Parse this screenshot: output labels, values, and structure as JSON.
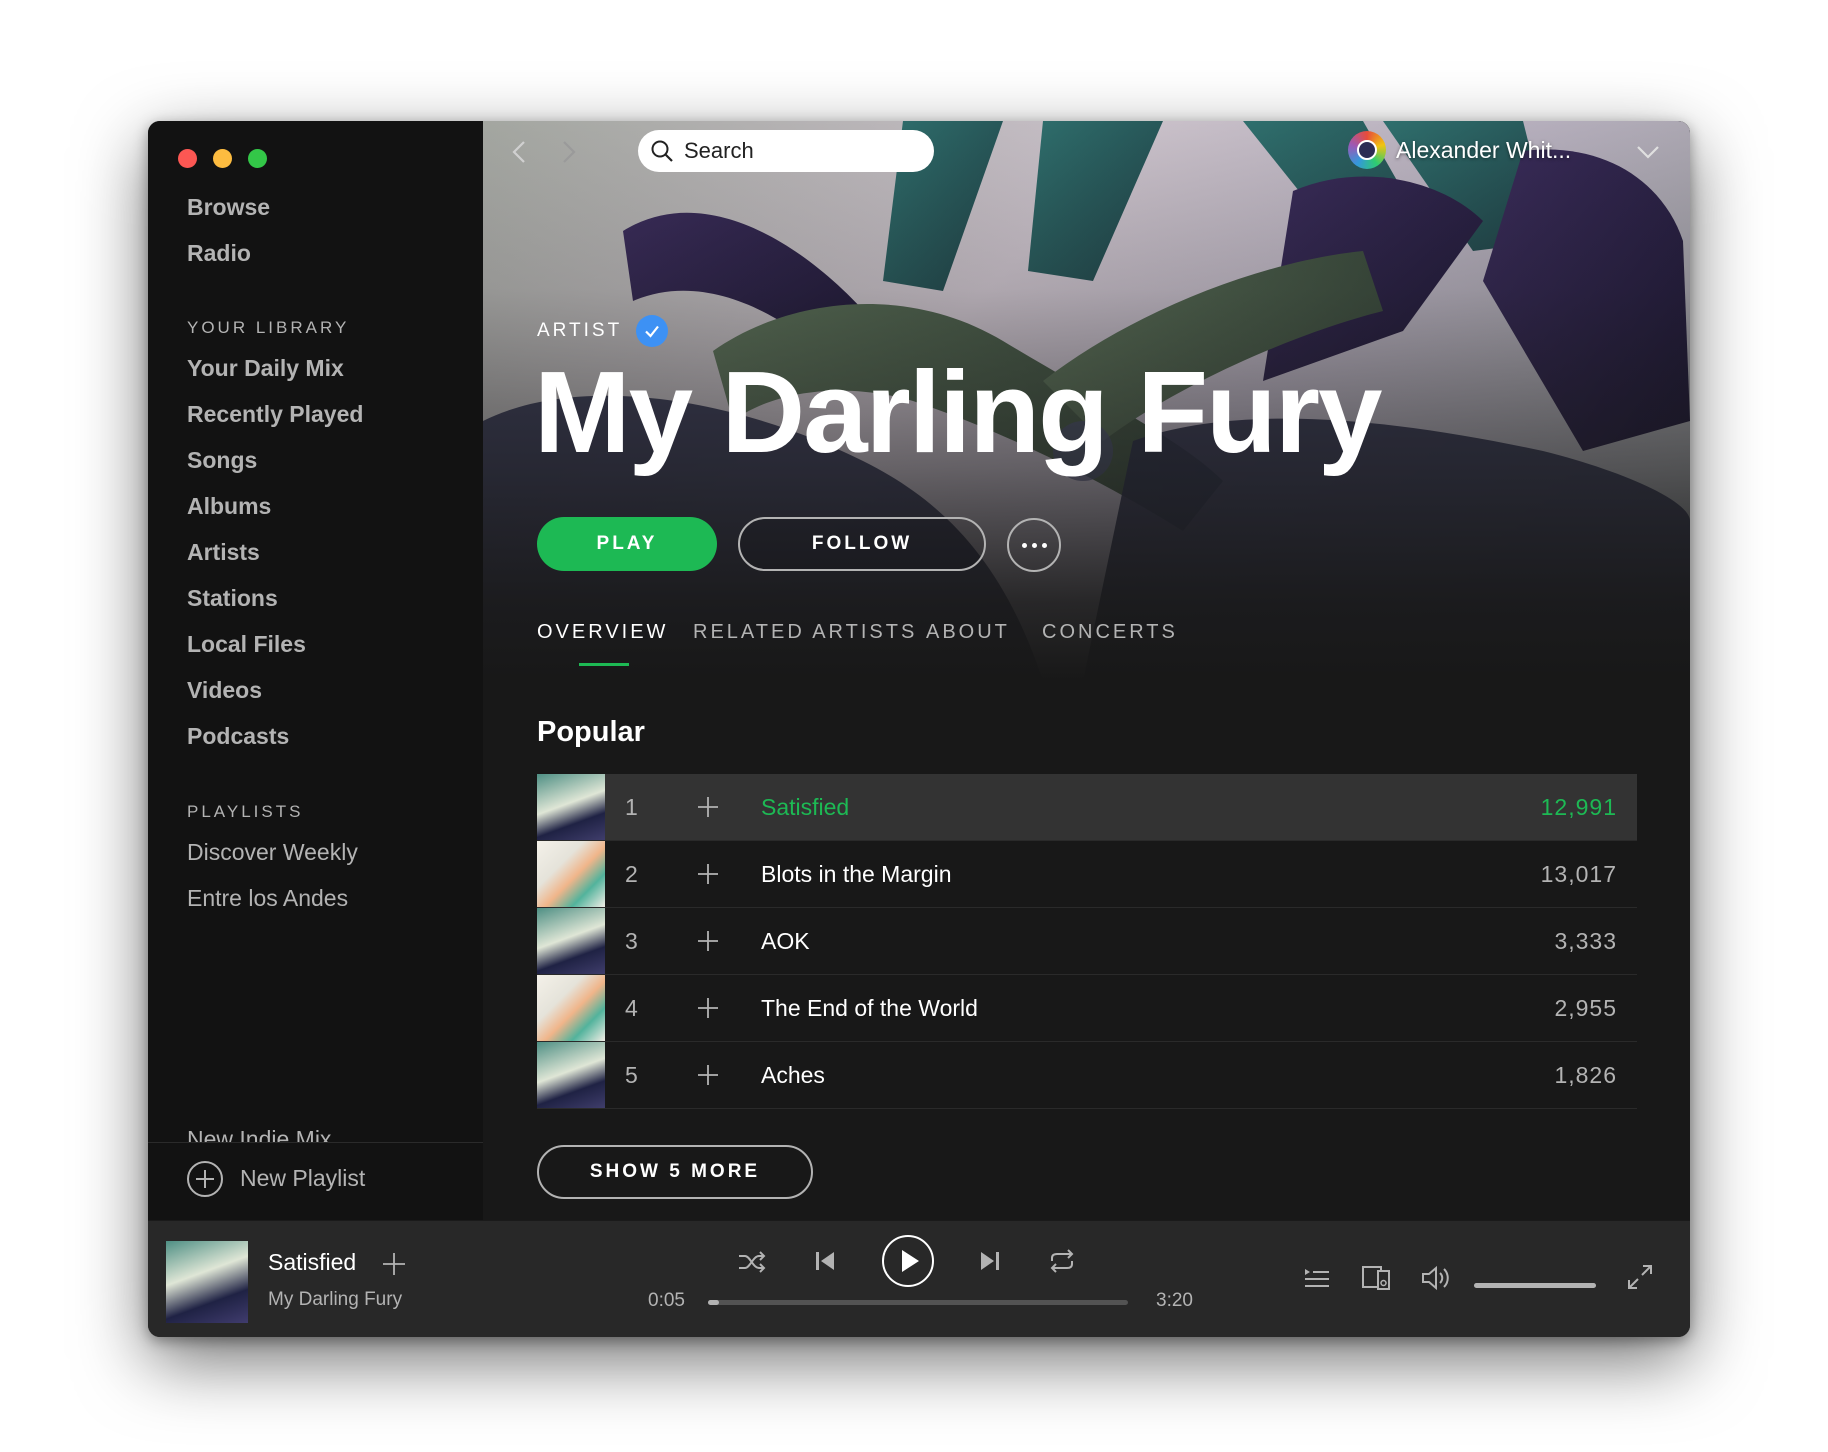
{
  "sidebar": {
    "main_nav": [
      "Browse",
      "Radio"
    ],
    "library_heading": "YOUR LIBRARY",
    "library_items": [
      "Your Daily Mix",
      "Recently Played",
      "Songs",
      "Albums",
      "Artists",
      "Stations",
      "Local Files",
      "Videos",
      "Podcasts"
    ],
    "playlists_heading": "PLAYLISTS",
    "playlists": [
      "Discover Weekly",
      "Entre los Andes",
      "New Indie Mix"
    ],
    "new_playlist_label": "New Playlist"
  },
  "topbar": {
    "search_placeholder": "Search",
    "user_name": "Alexander Whit..."
  },
  "artist": {
    "label": "ARTIST",
    "verified": true,
    "name": "My Darling Fury",
    "play_label": "PLAY",
    "follow_label": "FOLLOW"
  },
  "tabs": [
    "OVERVIEW",
    "RELATED ARTISTS",
    "ABOUT",
    "CONCERTS"
  ],
  "active_tab": "OVERVIEW",
  "popular": {
    "title": "Popular",
    "tracks": [
      {
        "num": "1",
        "name": "Satisfied",
        "plays": "12,991",
        "active": true
      },
      {
        "num": "2",
        "name": "Blots in the Margin",
        "plays": "13,017",
        "active": false
      },
      {
        "num": "3",
        "name": "AOK",
        "plays": "3,333",
        "active": false
      },
      {
        "num": "4",
        "name": "The End of the World",
        "plays": "2,955",
        "active": false
      },
      {
        "num": "5",
        "name": "Aches",
        "plays": "1,826",
        "active": false
      }
    ],
    "show_more_label": "SHOW 5 MORE"
  },
  "now_playing": {
    "title": "Satisfied",
    "artist": "My Darling Fury",
    "elapsed": "0:05",
    "duration": "3:20",
    "progress_fraction": 0.025,
    "volume_fraction": 1.0
  },
  "colors": {
    "accent_green": "#1db954",
    "verified_blue": "#3d91f4",
    "sidebar_bg": "#121212",
    "main_bg": "#181818",
    "player_bg": "#282828"
  }
}
